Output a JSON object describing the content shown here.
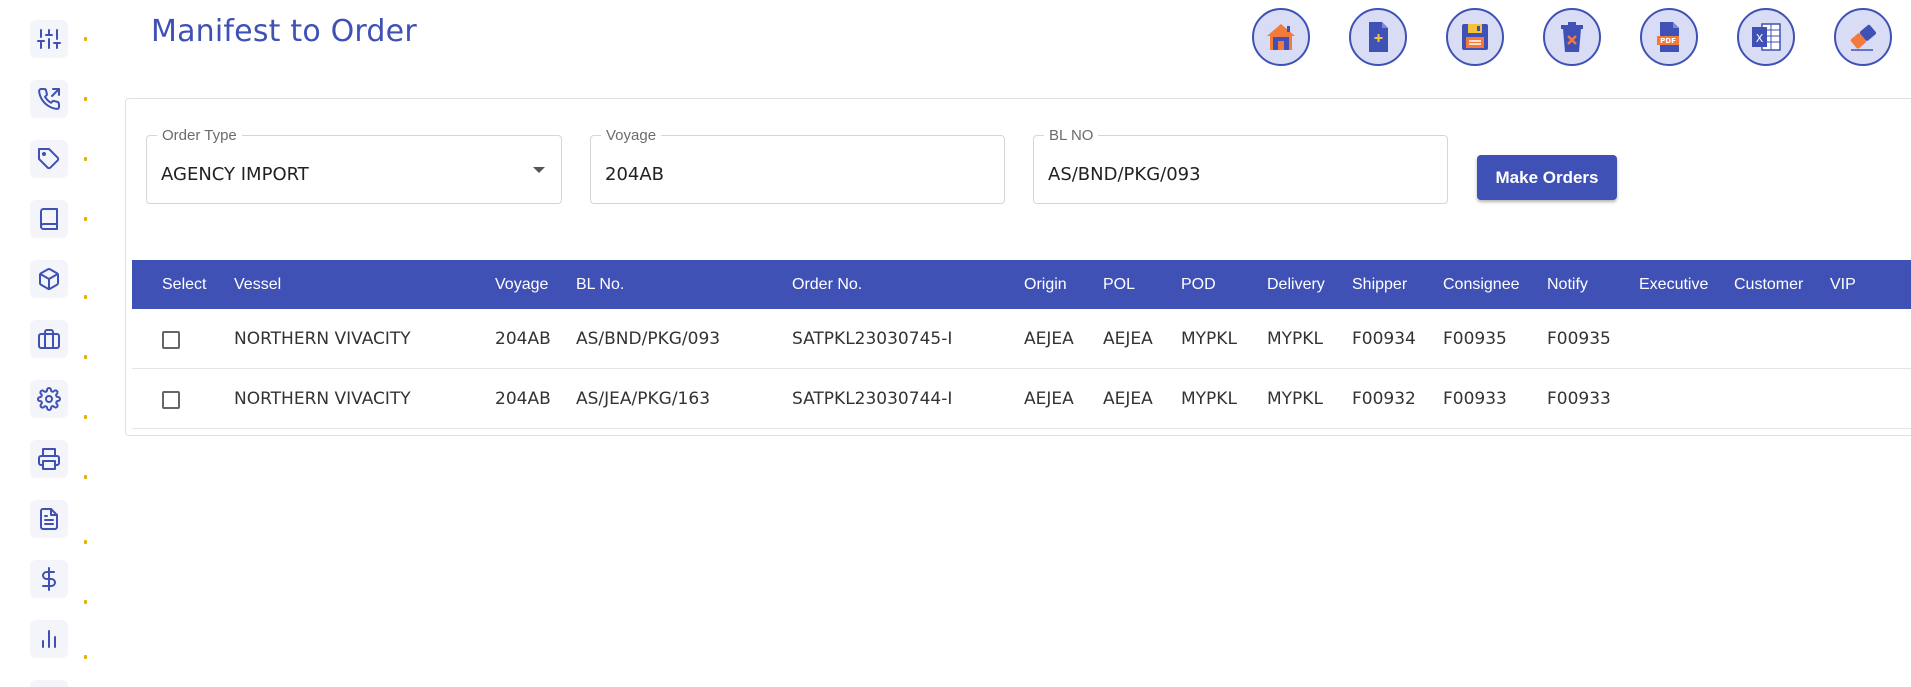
{
  "page": {
    "title": "Manifest to Order"
  },
  "sidebar": {
    "items": [
      {
        "icon": "sliders-icon"
      },
      {
        "icon": "phone-icon"
      },
      {
        "icon": "tag-icon"
      },
      {
        "icon": "book-icon"
      },
      {
        "icon": "box-icon"
      },
      {
        "icon": "briefcase-icon"
      },
      {
        "icon": "gear-icon"
      },
      {
        "icon": "printer-icon"
      },
      {
        "icon": "document-icon"
      },
      {
        "icon": "dollar-icon"
      },
      {
        "icon": "bar-chart-icon"
      }
    ]
  },
  "toolbar": {
    "buttons": [
      {
        "icon": "home-icon"
      },
      {
        "icon": "new-file-icon"
      },
      {
        "icon": "save-icon"
      },
      {
        "icon": "delete-icon"
      },
      {
        "icon": "pdf-icon"
      },
      {
        "icon": "excel-icon"
      },
      {
        "icon": "eraser-icon"
      }
    ]
  },
  "form": {
    "order_type": {
      "label": "Order Type",
      "value": "AGENCY IMPORT"
    },
    "voyage": {
      "label": "Voyage",
      "value": "204AB"
    },
    "bl_no": {
      "label": "BL NO",
      "value": "AS/BND/PKG/093"
    },
    "make_orders_label": "Make Orders"
  },
  "table": {
    "columns": [
      "Select",
      "Vessel",
      "Voyage",
      "BL No.",
      "Order No.",
      "Origin",
      "POL",
      "POD",
      "Delivery",
      "Shipper",
      "Consignee",
      "Notify",
      "Executive",
      "Customer",
      "VIP"
    ],
    "rows": [
      {
        "vessel": "NORTHERN VIVACITY",
        "voyage": "204AB",
        "bl_no": "AS/BND/PKG/093",
        "order_no": "SATPKL23030745-I",
        "origin": "AEJEA",
        "pol": "AEJEA",
        "pod": "MYPKL",
        "delivery": "MYPKL",
        "shipper": "F00934",
        "consignee": "F00935",
        "notify": "F00935",
        "executive": "",
        "customer": "",
        "vip": "",
        "selected": false
      },
      {
        "vessel": "NORTHERN VIVACITY",
        "voyage": "204AB",
        "bl_no": "AS/JEA/PKG/163",
        "order_no": "SATPKL23030744-I",
        "origin": "AEJEA",
        "pol": "AEJEA",
        "pod": "MYPKL",
        "delivery": "MYPKL",
        "shipper": "F00932",
        "consignee": "F00933",
        "notify": "F00933",
        "executive": "",
        "customer": "",
        "vip": "",
        "selected": false
      }
    ]
  },
  "colors": {
    "primary": "#3f51b5",
    "accent_orange": "#f47a3c"
  }
}
